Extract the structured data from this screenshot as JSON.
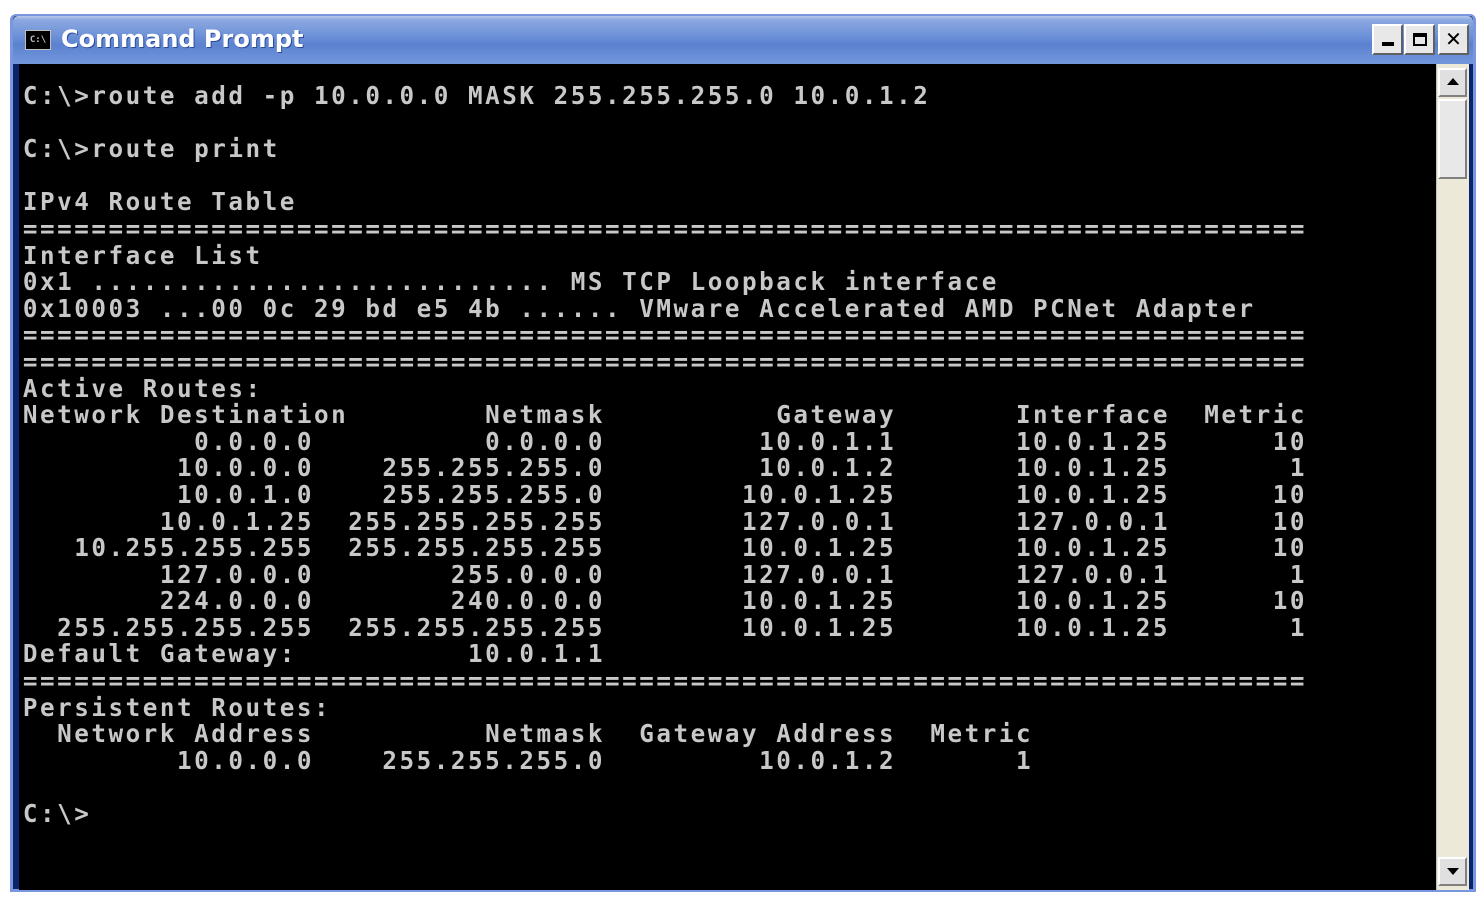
{
  "window": {
    "title": "Command Prompt",
    "icon": "console-icon",
    "icon_text": "C:\\"
  },
  "console": {
    "lines": [
      "C:\\>route add -p 10.0.0.0 MASK 255.255.255.0 10.0.1.2",
      "",
      "C:\\>route print",
      "",
      "IPv4 Route Table",
      "===========================================================================",
      "Interface List",
      "0x1 ........................... MS TCP Loopback interface",
      "0x10003 ...00 0c 29 bd e5 4b ...... VMware Accelerated AMD PCNet Adapter",
      "===========================================================================",
      "===========================================================================",
      "Active Routes:",
      "Network Destination        Netmask          Gateway       Interface  Metric",
      "          0.0.0.0          0.0.0.0         10.0.1.1       10.0.1.25      10",
      "         10.0.0.0    255.255.255.0         10.0.1.2       10.0.1.25       1",
      "         10.0.1.0    255.255.255.0        10.0.1.25       10.0.1.25      10",
      "        10.0.1.25  255.255.255.255        127.0.0.1       127.0.0.1      10",
      "   10.255.255.255  255.255.255.255        10.0.1.25       10.0.1.25      10",
      "        127.0.0.0        255.0.0.0        127.0.0.1       127.0.0.1       1",
      "        224.0.0.0        240.0.0.0        10.0.1.25       10.0.1.25      10",
      "  255.255.255.255  255.255.255.255        10.0.1.25       10.0.1.25       1",
      "Default Gateway:          10.0.1.1",
      "===========================================================================",
      "Persistent Routes:",
      "  Network Address          Netmask  Gateway Address  Metric",
      "         10.0.0.0    255.255.255.0         10.0.1.2       1",
      "",
      "C:\\>"
    ]
  },
  "colors": {
    "console_bg": "#000000",
    "console_fg": "#c8c8c8",
    "titlebar_accent": "#5b82d0"
  }
}
